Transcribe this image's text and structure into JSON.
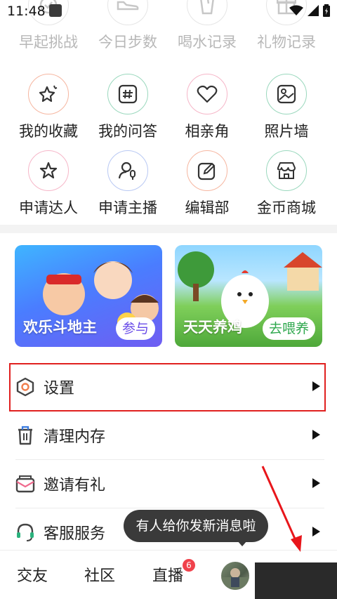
{
  "status_bar": {
    "time": "11:48"
  },
  "grid": {
    "row1": [
      {
        "label": "早起挑战",
        "icon": "alarm-icon"
      },
      {
        "label": "今日步数",
        "icon": "shoe-icon"
      },
      {
        "label": "喝水记录",
        "icon": "cup-icon"
      },
      {
        "label": "礼物记录",
        "icon": "gift-icon"
      }
    ],
    "row2": [
      {
        "label": "我的收藏",
        "icon": "star-sparkle-icon"
      },
      {
        "label": "我的问答",
        "icon": "hashtag-icon"
      },
      {
        "label": "相亲角",
        "icon": "heart-icon"
      },
      {
        "label": "照片墙",
        "icon": "photo-icon"
      }
    ],
    "row3": [
      {
        "label": "申请达人",
        "icon": "star-icon"
      },
      {
        "label": "申请主播",
        "icon": "microphone-user-icon"
      },
      {
        "label": "编辑部",
        "icon": "edit-icon"
      },
      {
        "label": "金币商城",
        "icon": "store-icon"
      }
    ]
  },
  "banners": {
    "left": {
      "title": "欢乐斗地主",
      "button": "参与"
    },
    "right": {
      "title": "天天养鸡",
      "button": "去喂养"
    }
  },
  "menu": {
    "settings": "设置",
    "clear_cache": "清理内存",
    "invite": "邀请有礼",
    "customer_service": "客服服务"
  },
  "toast": {
    "text": "有人给你发新消息啦"
  },
  "tabbar": {
    "friends": "交友",
    "community": "社区",
    "live": "直播",
    "live_badge": "6"
  },
  "colors": {
    "highlight_border": "#e0201f",
    "icon_orange": "#f07e4c",
    "icon_pink": "#f06a8e",
    "icon_green": "#2bb27d",
    "icon_blue": "#5a7fe0",
    "button_purple": "#6a4de8",
    "button_green": "#2fa84e"
  }
}
